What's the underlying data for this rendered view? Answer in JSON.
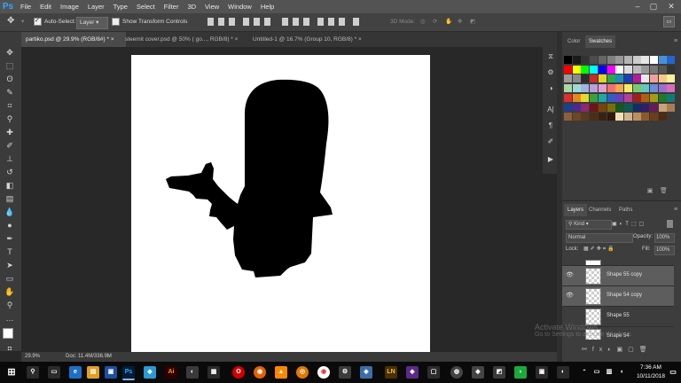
{
  "app": {
    "logo": "Ps"
  },
  "menu": [
    "File",
    "Edit",
    "Image",
    "Layer",
    "Type",
    "Select",
    "Filter",
    "3D",
    "View",
    "Window",
    "Help"
  ],
  "options_bar": {
    "auto_select_label": "Auto-Select:",
    "auto_select_value": "Layer",
    "transform_label": "Show Transform Controls",
    "mode_label": "3D Mode:"
  },
  "tabs": [
    {
      "label": "partiko.psd @ 29.9% (RGB/8#) *",
      "active": true
    },
    {
      "label": "steemit cover.psd @ 50% ( go..., RGB/8) *",
      "active": false
    },
    {
      "label": "Untitled-1 @ 16.7% (Group 10, RGB/8) *",
      "active": false
    }
  ],
  "status": {
    "zoom": "29.9%",
    "doc": "Doc: 11.4M/336.9M"
  },
  "color_panel": {
    "tab_color": "Color",
    "tab_swatches": "Swatches"
  },
  "swatches": [
    "#000000",
    "#1a1a1a",
    "#333333",
    "#4d4d4d",
    "#666666",
    "#808080",
    "#999999",
    "#b3b3b3",
    "#cccccc",
    "#e6e6e6",
    "#ffffff",
    "#4a90d9",
    "#2266cc",
    "#ff0000",
    "#ffff00",
    "#00ff00",
    "#00ffff",
    "#0000ff",
    "#ff00ff",
    "#ffffff",
    "#dddddd",
    "#bbbbbb",
    "#999999",
    "#777777",
    "#555555",
    "#333333",
    "#9b9b9b",
    "#8a8a8a",
    "#2b2b2b",
    "#c82c2c",
    "#e3d32a",
    "#2aa84a",
    "#1c8fb5",
    "#1c3fb5",
    "#b51c9a",
    "#e8e8e8",
    "#f0a0a0",
    "#f5c98a",
    "#f7f1a0",
    "#aad8a0",
    "#9fd9d6",
    "#9fb4e0",
    "#b9a0d9",
    "#e0a0cf",
    "#f07070",
    "#f5a650",
    "#f2ec6a",
    "#7bc86e",
    "#63c6c2",
    "#6b8fd6",
    "#9a6fd0",
    "#d66fb8",
    "#d93030",
    "#e6871f",
    "#e6d82b",
    "#3aa23a",
    "#1fa8a3",
    "#2f5fc4",
    "#6b3fb8",
    "#b83f98",
    "#9e1f1f",
    "#b05e12",
    "#a89a10",
    "#1f7a2a",
    "#127a76",
    "#1f3f8c",
    "#4a2a8c",
    "#8c2a6e",
    "#6e1414",
    "#7a420c",
    "#7a6e0a",
    "#125a1c",
    "#0c5a56",
    "#142c66",
    "#341c66",
    "#661c52",
    "#c9a17a",
    "#a87c52",
    "#8c603a",
    "#6e4626",
    "#5a3a1e",
    "#4a2e16",
    "#3a2210",
    "#2e1a0c",
    "#f5deb3",
    "#d2b48c",
    "#bc8f5f",
    "#8b5a2b",
    "#6b3e1b",
    "#4e2a12"
  ],
  "layers_panel": {
    "tab_layers": "Layers",
    "tab_channels": "Channels",
    "tab_paths": "Paths",
    "filter": "Kind",
    "blend": "Normal",
    "opacity_label": "Opacity:",
    "opacity": "100%",
    "lock_label": "Lock:",
    "fill_label": "Fill:",
    "fill": "100%",
    "layers": [
      {
        "name": "Shape 55 copy",
        "visible": true,
        "selected": true
      },
      {
        "name": "Shape 54 copy",
        "visible": true,
        "selected": true
      },
      {
        "name": "Shape 55",
        "visible": false,
        "selected": false
      },
      {
        "name": "Shape 54",
        "visible": false,
        "selected": false
      }
    ]
  },
  "watermark": {
    "line1": "Activate Windows",
    "line2": "Go to Settings to activate Windows."
  },
  "clock": {
    "time": "7:36 AM",
    "date": "10/11/2018"
  }
}
